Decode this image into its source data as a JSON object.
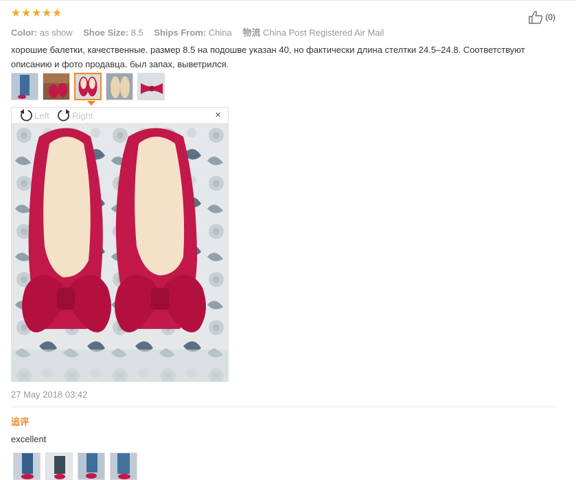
{
  "review": {
    "rating": 5,
    "stars": [
      "★",
      "★",
      "★",
      "★",
      "★"
    ],
    "attributes": [
      {
        "label": "Color:",
        "value": "as show"
      },
      {
        "label": "Shoe Size:",
        "value": "8.5"
      },
      {
        "label": "Ships From:",
        "value": "China"
      },
      {
        "label": "物流",
        "value": "China Post Registered Air Mail"
      }
    ],
    "helpful_count": "(0)",
    "text": "хорошие балетки, качественные. размер 8.5 на подошве указан 40, но фактически длина стелтки 24.5–24.8. Соответствуют описанию и фото продавца. был запах, выветрился.",
    "thumbnails": [
      "thumb-1",
      "thumb-2",
      "thumb-3",
      "thumb-4",
      "thumb-5"
    ],
    "active_thumbnail": 3,
    "viewer": {
      "rotate_left_label": "Left",
      "rotate_right_label": "Right",
      "close_label": "×"
    },
    "date": "27 May 2018 03:42"
  },
  "followup": {
    "heading": "追评",
    "text": "excellent",
    "thumbnails": [
      "fu-thumb-1",
      "fu-thumb-2",
      "fu-thumb-3",
      "fu-thumb-4"
    ]
  },
  "colors": {
    "star": "#f6a623",
    "accent": "#f08a24",
    "muted_text": "#999999",
    "shoe": "#c2184a"
  }
}
